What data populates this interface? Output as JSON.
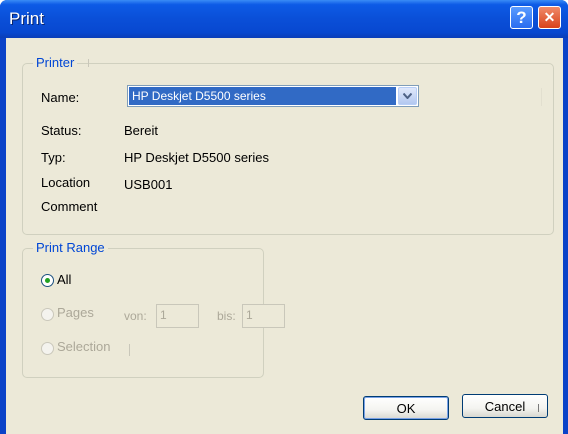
{
  "window": {
    "title": "Print",
    "help_glyph": "?",
    "close_glyph": "✕"
  },
  "printer": {
    "legend": "Printer",
    "name_label": "Name:",
    "name_value": "HP Deskjet D5500 series",
    "status_label": "Status:",
    "status_value": "Bereit",
    "type_label": "Typ:",
    "type_value": "HP Deskjet D5500 series",
    "location_label": "Location",
    "location_value": "USB001",
    "comment_label": "Comment",
    "comment_value": ""
  },
  "print_range": {
    "legend": "Print Range",
    "all_label": "All",
    "all_selected": true,
    "pages_label": "Pages",
    "from_label": "von:",
    "from_value": "1",
    "to_label": "bis:",
    "to_value": "1",
    "selection_label": "Selection"
  },
  "buttons": {
    "ok_label": "OK",
    "cancel_label": "Cancel"
  },
  "colors": {
    "title_bar": "#0a4fd8",
    "dialog_bg": "#ece9d8",
    "legend_text": "#0046d5",
    "selection_bg": "#316ac5",
    "disabled_text": "#aca899"
  }
}
